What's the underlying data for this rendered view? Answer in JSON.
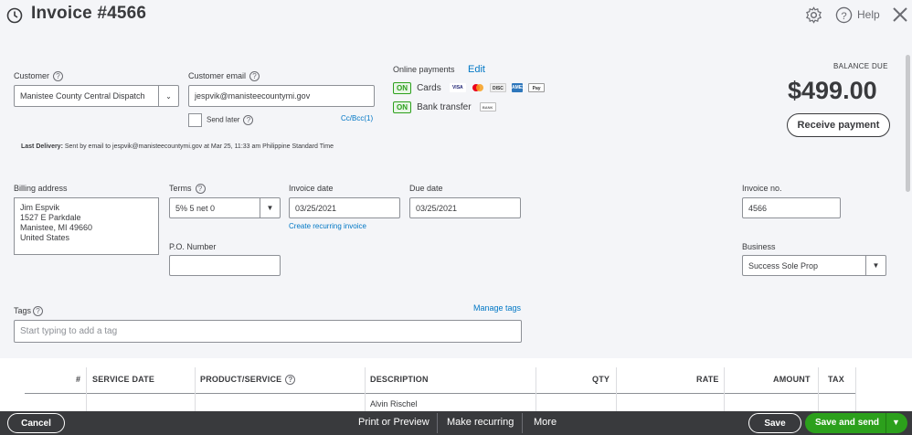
{
  "header": {
    "title": "Invoice #4566",
    "help_label": "Help"
  },
  "customer": {
    "label": "Customer",
    "value": "Manistee County Central Dispatch"
  },
  "customer_email": {
    "label": "Customer email",
    "value": "jespvik@manisteecountymi.gov",
    "send_later_label": "Send later",
    "cc_bcc": "Cc/Bcc(1)"
  },
  "online_payments": {
    "label": "Online payments",
    "edit_label": "Edit",
    "cards_status": "ON",
    "cards_label": "Cards",
    "card_logos": [
      "VISA",
      "MC",
      "DISC",
      "AMEX",
      "Pay"
    ],
    "bank_status": "ON",
    "bank_label": "Bank transfer",
    "bank_logo": "BANK"
  },
  "balance": {
    "label": "BALANCE DUE",
    "amount": "$499.00",
    "receive_payment_label": "Receive payment"
  },
  "last_delivery": {
    "label": "Last Delivery:",
    "text": "Sent by email to jespvik@manisteecountymi.gov at Mar 25, 11:33 am Philippine Standard Time"
  },
  "billing": {
    "label": "Billing address",
    "lines": [
      "Jim Espvik",
      "1527 E Parkdale",
      "Manistee, MI  49660",
      "United States"
    ]
  },
  "terms": {
    "label": "Terms",
    "value": "5% 5 net 0"
  },
  "invoice_date": {
    "label": "Invoice date",
    "value": "03/25/2021",
    "recurring_link": "Create recurring invoice"
  },
  "due_date": {
    "label": "Due date",
    "value": "03/25/2021"
  },
  "invoice_no": {
    "label": "Invoice no.",
    "value": "4566"
  },
  "po_number": {
    "label": "P.O. Number",
    "value": ""
  },
  "business": {
    "label": "Business",
    "value": "Success Sole Prop"
  },
  "tags": {
    "label": "Tags",
    "manage_label": "Manage tags",
    "placeholder": "Start typing to add a tag"
  },
  "table": {
    "headers": [
      "#",
      "SERVICE DATE",
      "PRODUCT/SERVICE",
      "DESCRIPTION",
      "QTY",
      "RATE",
      "AMOUNT",
      "TAX"
    ],
    "partial_description": "Alvin Rischel"
  },
  "footer": {
    "cancel_label": "Cancel",
    "print_preview_label": "Print or Preview",
    "make_recurring_label": "Make recurring",
    "more_label": "More",
    "save_label": "Save",
    "save_send_label": "Save and send"
  },
  "colors": {
    "accent_green": "#2ca01c",
    "link_blue": "#0077c5",
    "footer_bg": "#393a3d"
  }
}
